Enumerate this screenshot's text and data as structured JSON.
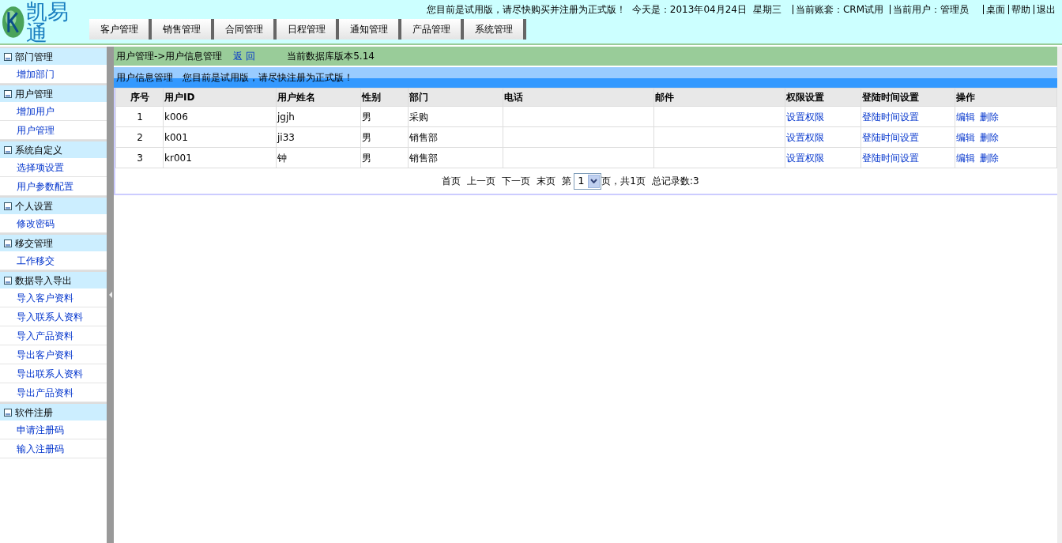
{
  "header": {
    "logo_text": "凯易通",
    "notice": "您目前是试用版，请尽快购买并注册为正式版！",
    "date": "今天是：2013年04月24日",
    "weekday": "星期三",
    "account": "当前账套：CRM试用",
    "user": "当前用户：管理员",
    "links": [
      "桌面",
      "帮助",
      "退出"
    ]
  },
  "nav_tabs": [
    {
      "label": "客户管理",
      "selected": false
    },
    {
      "label": "销售管理",
      "selected": false
    },
    {
      "label": "合同管理",
      "selected": false
    },
    {
      "label": "日程管理",
      "selected": false
    },
    {
      "label": "通知管理",
      "selected": false
    },
    {
      "label": "产品管理",
      "selected": false
    },
    {
      "label": "系统管理",
      "selected": false
    }
  ],
  "sidebar": [
    {
      "title": "部门管理",
      "items": [
        "增加部门"
      ]
    },
    {
      "title": "用户管理",
      "items": [
        "增加用户",
        "用户管理"
      ]
    },
    {
      "title": "系统自定义",
      "items": [
        "选择项设置",
        "用户参数配置"
      ]
    },
    {
      "title": "个人设置",
      "items": [
        "修改密码"
      ]
    },
    {
      "title": "移交管理",
      "items": [
        "工作移交"
      ]
    },
    {
      "title": "数据导入导出",
      "items": [
        "导入客户资料",
        "导入联系人资料",
        "导入产品资料",
        "导出客户资料",
        "导出联系人资料",
        "导出产品资料"
      ]
    },
    {
      "title": "软件注册",
      "items": [
        "申请注册码",
        "输入注册码"
      ]
    }
  ],
  "breadcrumb": {
    "path": "用户管理->用户信息管理",
    "back": "返 回",
    "version": "当前数据库版本5.14"
  },
  "panel": {
    "title": "用户信息管理",
    "notice": "您目前是试用版，请尽快注册为正式版！"
  },
  "table": {
    "columns": [
      "序号",
      "用户ID",
      "用户姓名",
      "性别",
      "部门",
      "电话",
      "邮件",
      "权限设置",
      "登陆时间设置",
      "操作"
    ],
    "rows": [
      {
        "no": "1",
        "id": "k006",
        "name": "jgjh",
        "sex": "男",
        "dept": "采购",
        "perm": "设置权限",
        "login": "登陆时间设置",
        "actions": [
          "编辑",
          "删除"
        ]
      },
      {
        "no": "2",
        "id": "k001",
        "name": "ji33",
        "sex": "男",
        "dept": "销售部",
        "perm": "设置权限",
        "login": "登陆时间设置",
        "actions": [
          "编辑",
          "删除"
        ]
      },
      {
        "no": "3",
        "id": "kr001",
        "name": "钟",
        "sex": "男",
        "dept": "销售部",
        "perm": "设置权限",
        "login": "登陆时间设置",
        "actions": [
          "编辑",
          "删除"
        ]
      }
    ]
  },
  "pagination": {
    "links": [
      "首页",
      "上一页",
      "下一页",
      "末页"
    ],
    "page_prefix": "第",
    "page": "1",
    "page_suffix": "页，共1页",
    "total": "总记录数:3"
  }
}
